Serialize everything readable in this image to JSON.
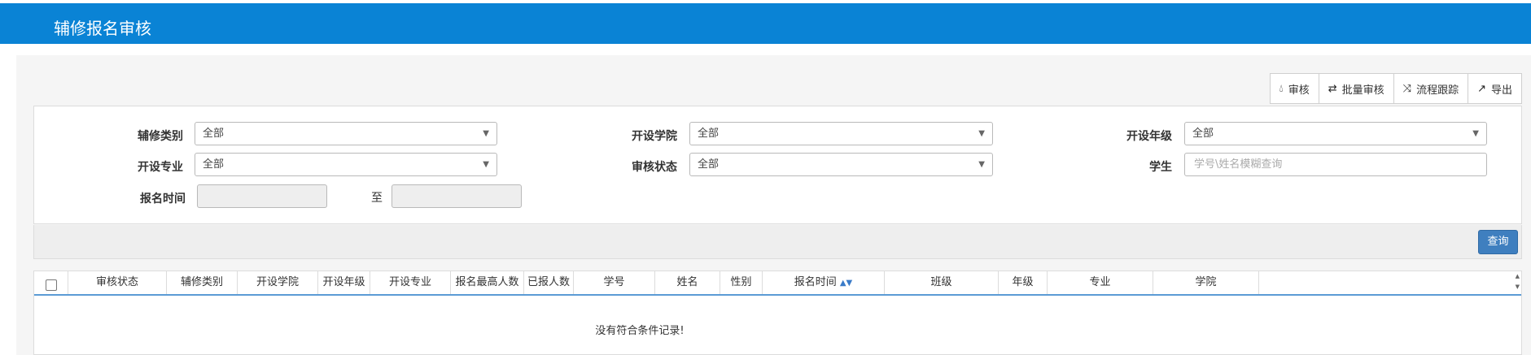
{
  "header": {
    "title": "辅修报名审核"
  },
  "toolbar": {
    "buttons": [
      {
        "label": "审核",
        "icon": "drop-icon"
      },
      {
        "label": "批量审核",
        "icon": "exchange-icon"
      },
      {
        "label": "流程跟踪",
        "icon": "random-icon"
      },
      {
        "label": "导出",
        "icon": "export-icon"
      }
    ]
  },
  "filters": {
    "minor_type": {
      "label": "辅修类别",
      "value": "全部"
    },
    "college": {
      "label": "开设学院",
      "value": "全部"
    },
    "grade": {
      "label": "开设年级",
      "value": "全部"
    },
    "major": {
      "label": "开设专业",
      "value": "全部"
    },
    "review_status": {
      "label": "审核状态",
      "value": "全部"
    },
    "student": {
      "label": "学生",
      "placeholder": "学号\\姓名模糊查询"
    },
    "signup_time": {
      "label": "报名时间",
      "to": "至"
    }
  },
  "actions": {
    "query_label": "查询"
  },
  "table": {
    "columns": [
      "审核状态",
      "辅修类别",
      "开设学院",
      "开设年级",
      "开设专业",
      "报名最高人数",
      "已报人数",
      "学号",
      "姓名",
      "性别",
      "报名时间",
      "班级",
      "年级",
      "专业",
      "学院"
    ],
    "empty_message": "没有符合条件记录!"
  },
  "colors": {
    "header_bg": "#0a83d5",
    "primary_button": "#3f7fbf",
    "table_header_border": "#5b9bd5"
  }
}
